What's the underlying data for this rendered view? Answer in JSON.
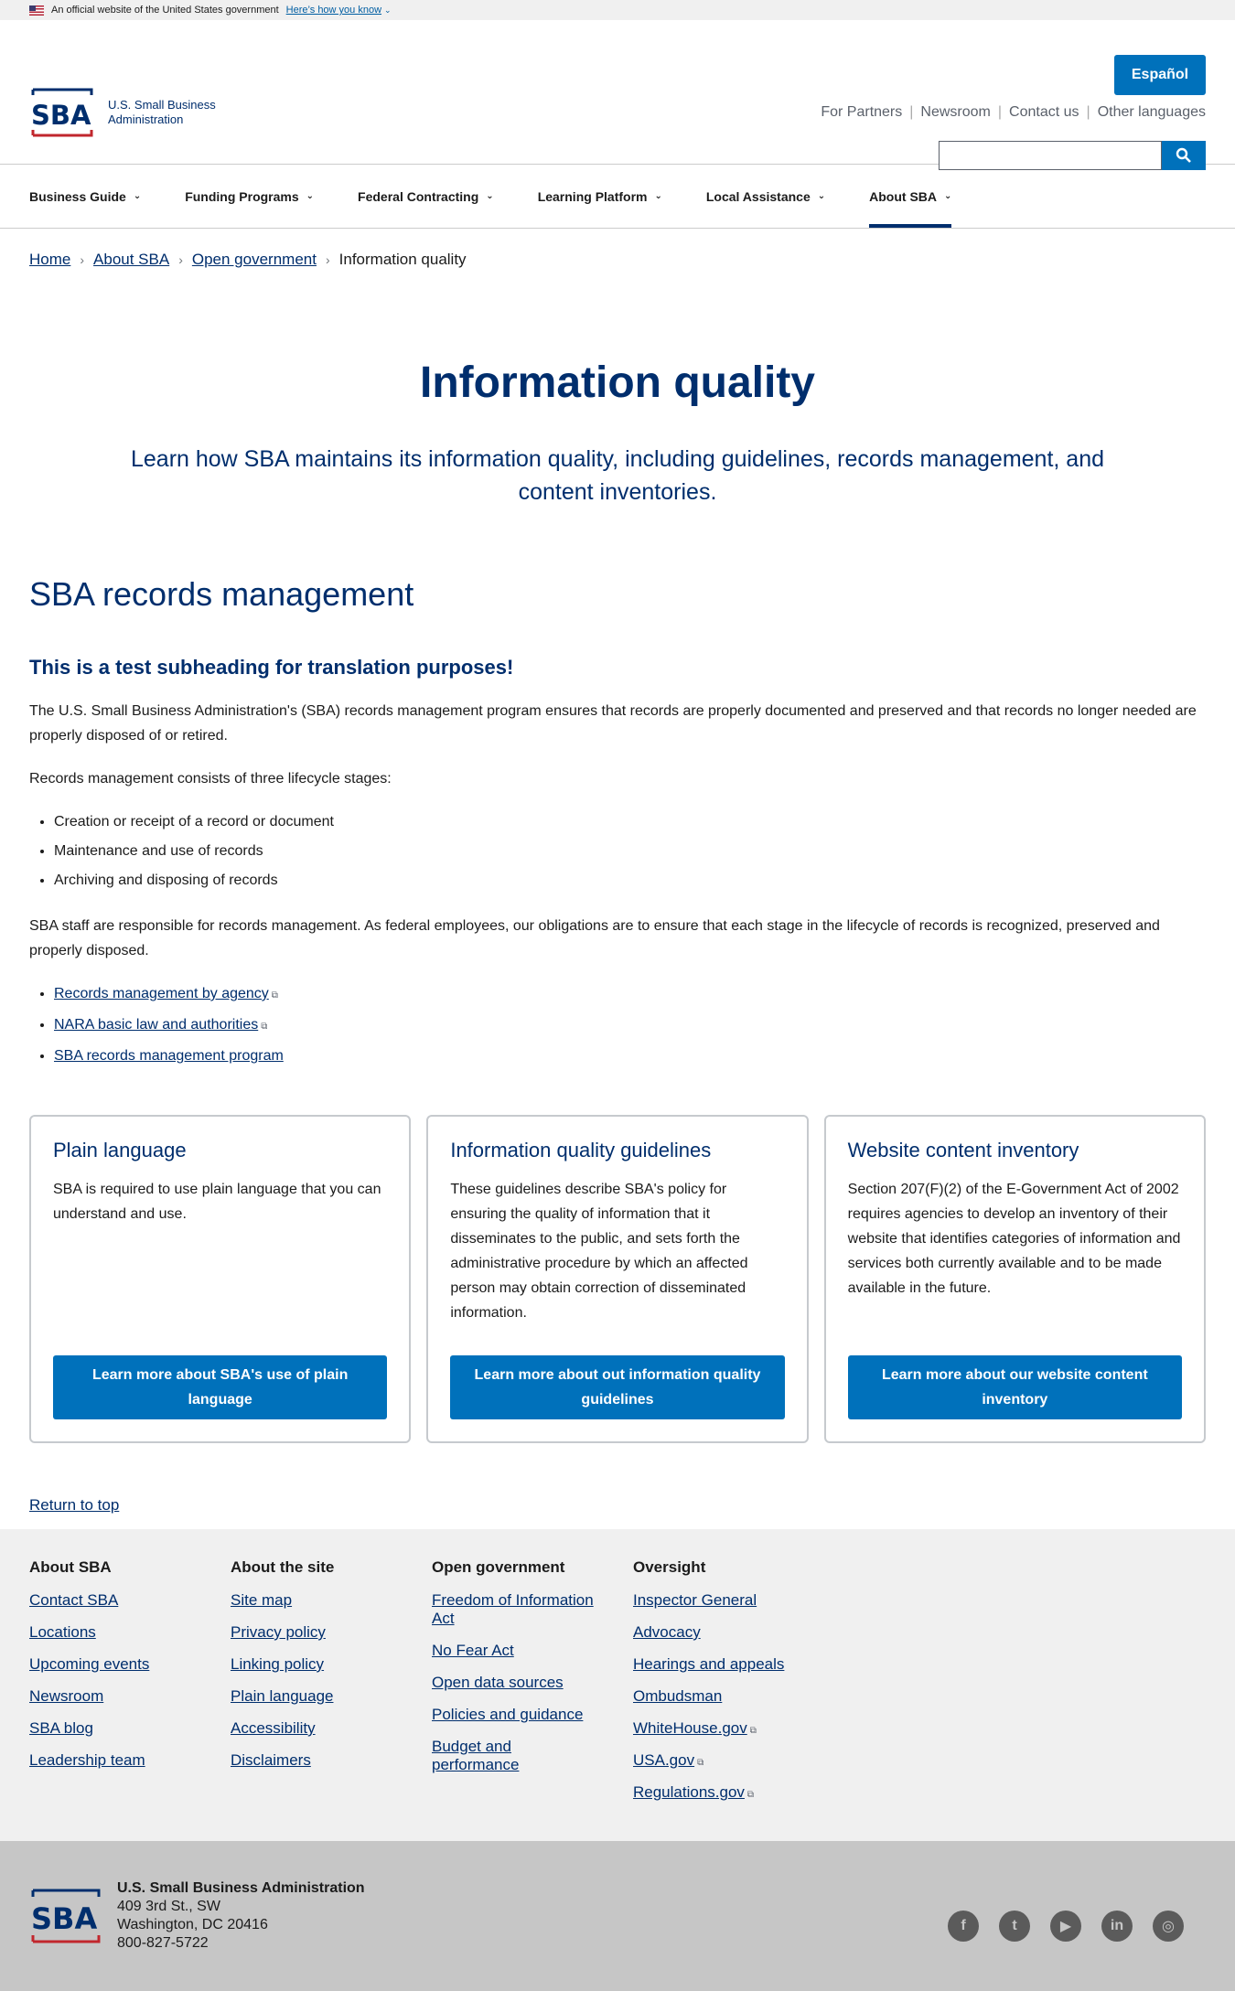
{
  "banner": {
    "text": "An official website of the United States government",
    "know": "Here’s how you know"
  },
  "header": {
    "logo_line1": "U.S. Small Business",
    "logo_line2": "Administration",
    "espanol": "Español",
    "utility": [
      "For Partners",
      "Newsroom",
      "Contact us",
      "Other languages"
    ],
    "search_placeholder": ""
  },
  "nav": [
    "Business Guide",
    "Funding Programs",
    "Federal Contracting",
    "Learning Platform",
    "Local Assistance",
    "About SBA"
  ],
  "breadcrumb": [
    "Home",
    "About SBA",
    "Open government",
    "Information quality"
  ],
  "hero": {
    "title": "Information quality",
    "subtitle": "Learn how SBA maintains its information quality, including guidelines, records management, and content inventories."
  },
  "content": {
    "h2": "SBA records management",
    "h3": "This is a test subheading for translation purposes!",
    "p1": "The U.S. Small Business Administration's (SBA) records management program ensures that records are properly documented and preserved and that records no longer needed are properly disposed of or retired.",
    "p2": "Records management consists of three lifecycle stages:",
    "stages": [
      "Creation or receipt of a record or document",
      "Maintenance and use of records",
      "Archiving and disposing of records"
    ],
    "p3": "SBA staff are responsible for records management. As federal employees, our obligations are to ensure that each stage in the lifecycle of records is recognized, preserved and properly disposed.",
    "links": [
      "Records management by agency",
      "NARA basic law and authorities",
      "SBA records management program"
    ]
  },
  "cards": [
    {
      "title": "Plain language",
      "body": "SBA is required to use plain language that you can understand and use.",
      "button": "Learn more about SBA's use of plain language"
    },
    {
      "title": "Information quality guidelines",
      "body": "These guidelines describe SBA's policy for ensuring the quality of information that it disseminates to the public, and sets forth the administrative procedure by which an affected person may obtain correction of disseminated information.",
      "button": "Learn more about out information quality guidelines"
    },
    {
      "title": "Website content inventory",
      "body": "Section 207(F)(2) of the E-Government Act of 2002 requires agencies to develop an inventory of their website that identifies categories of information and services both currently available and to be made available in the future.",
      "button": "Learn more about our website content inventory"
    }
  ],
  "return_top": "Return to top",
  "footer": {
    "cols": [
      {
        "title": "About SBA",
        "links": [
          "Contact SBA",
          "Locations",
          "Upcoming events",
          "Newsroom",
          "SBA blog",
          "Leadership team"
        ]
      },
      {
        "title": "About the site",
        "links": [
          "Site map",
          "Privacy policy",
          "Linking policy",
          "Plain language",
          "Accessibility",
          "Disclaimers"
        ]
      },
      {
        "title": "Open government",
        "links": [
          "Freedom of Information Act",
          "No Fear Act",
          "Open data sources",
          "Policies and guidance",
          "Budget and performance"
        ]
      },
      {
        "title": "Oversight",
        "links": [
          "Inspector General",
          "Advocacy",
          "Hearings and appeals",
          "Ombudsman",
          "WhiteHouse.gov",
          "USA.gov",
          "Regulations.gov"
        ]
      }
    ],
    "org": "U.S. Small Business Administration",
    "addr1": "409 3rd St., SW",
    "addr2": "Washington, DC 20416",
    "phone": "800-827-5722",
    "social": [
      "facebook-icon",
      "twitter-icon",
      "youtube-icon",
      "linkedin-icon",
      "instagram-icon"
    ]
  }
}
